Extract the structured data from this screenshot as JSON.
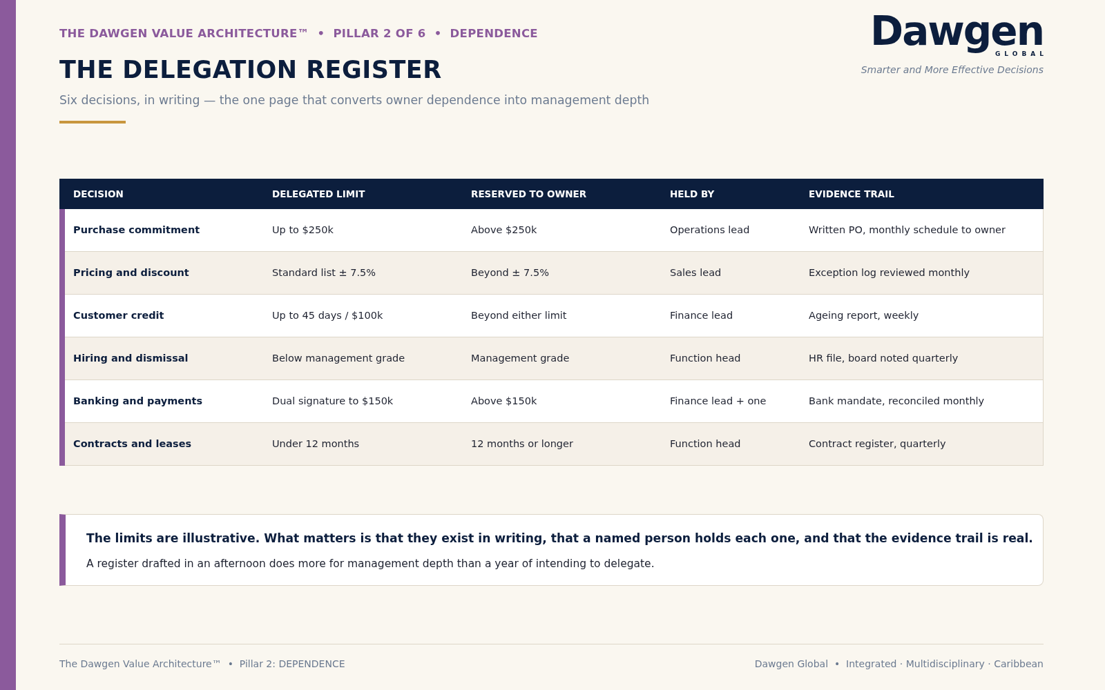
{
  "header": {
    "eyebrow": "THE DAWGEN VALUE ARCHITECTURE™  •  PILLAR 2 OF 6  •  DEPENDENCE",
    "title": "THE DELEGATION REGISTER",
    "subtitle": "Six decisions, in writing — the one page that converts owner dependence into management depth"
  },
  "logo": {
    "wordmark": "Dawgen",
    "sub": "GLOBAL",
    "tagline": "Smarter and More Effective Decisions"
  },
  "table": {
    "columns": [
      "DECISION",
      "DELEGATED LIMIT",
      "RESERVED TO OWNER",
      "HELD BY",
      "EVIDENCE TRAIL"
    ],
    "rows": [
      [
        "Purchase commitment",
        "Up to $250k",
        "Above $250k",
        "Operations lead",
        "Written PO, monthly schedule to owner"
      ],
      [
        "Pricing and discount",
        "Standard list ± 7.5%",
        "Beyond ± 7.5%",
        "Sales lead",
        "Exception log reviewed monthly"
      ],
      [
        "Customer credit",
        "Up to 45 days / $100k",
        "Beyond either limit",
        "Finance lead",
        "Ageing report, weekly"
      ],
      [
        "Hiring and dismissal",
        "Below management grade",
        "Management grade",
        "Function head",
        "HR file, board noted quarterly"
      ],
      [
        "Banking and payments",
        "Dual signature to $150k",
        "Above $150k",
        "Finance lead + one",
        "Bank mandate, reconciled monthly"
      ],
      [
        "Contracts and leases",
        "Under 12 months",
        "12 months or longer",
        "Function head",
        "Contract register, quarterly"
      ]
    ]
  },
  "note": {
    "lead": "The limits are illustrative. What matters is that they exist in writing, that a named person holds each one, and that the evidence trail is real.",
    "body": "A register drafted in an afternoon does more for management depth than a year of intending to delegate."
  },
  "footer": {
    "left": "The Dawgen Value Architecture™  •  Pillar 2: DEPENDENCE",
    "right": "Dawgen Global  •  Integrated · Multidisciplinary · Caribbean"
  }
}
